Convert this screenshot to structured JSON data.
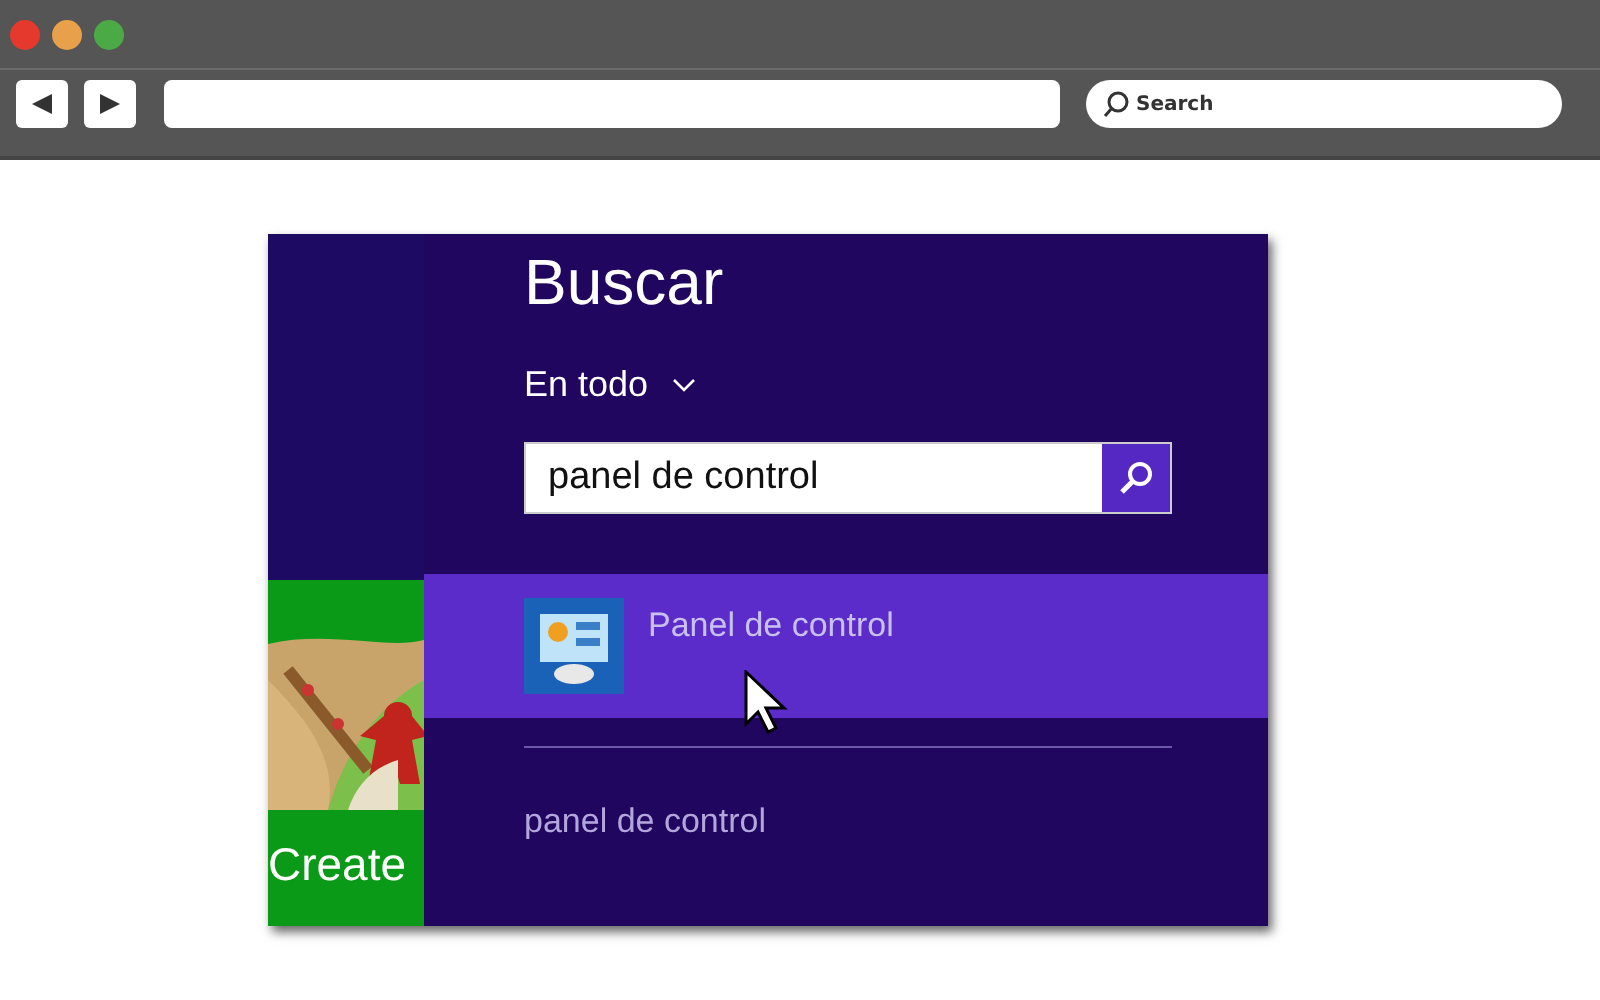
{
  "browser": {
    "search_placeholder": "Search"
  },
  "start_tiles": [
    {
      "kind": "picture"
    },
    {
      "label": "Create"
    }
  ],
  "search_panel": {
    "title": "Buscar",
    "scope": "En todo",
    "query": "panel de control",
    "results": [
      {
        "label": "Panel de control",
        "selected": true
      }
    ],
    "suggestions": [
      "panel de control"
    ]
  }
}
